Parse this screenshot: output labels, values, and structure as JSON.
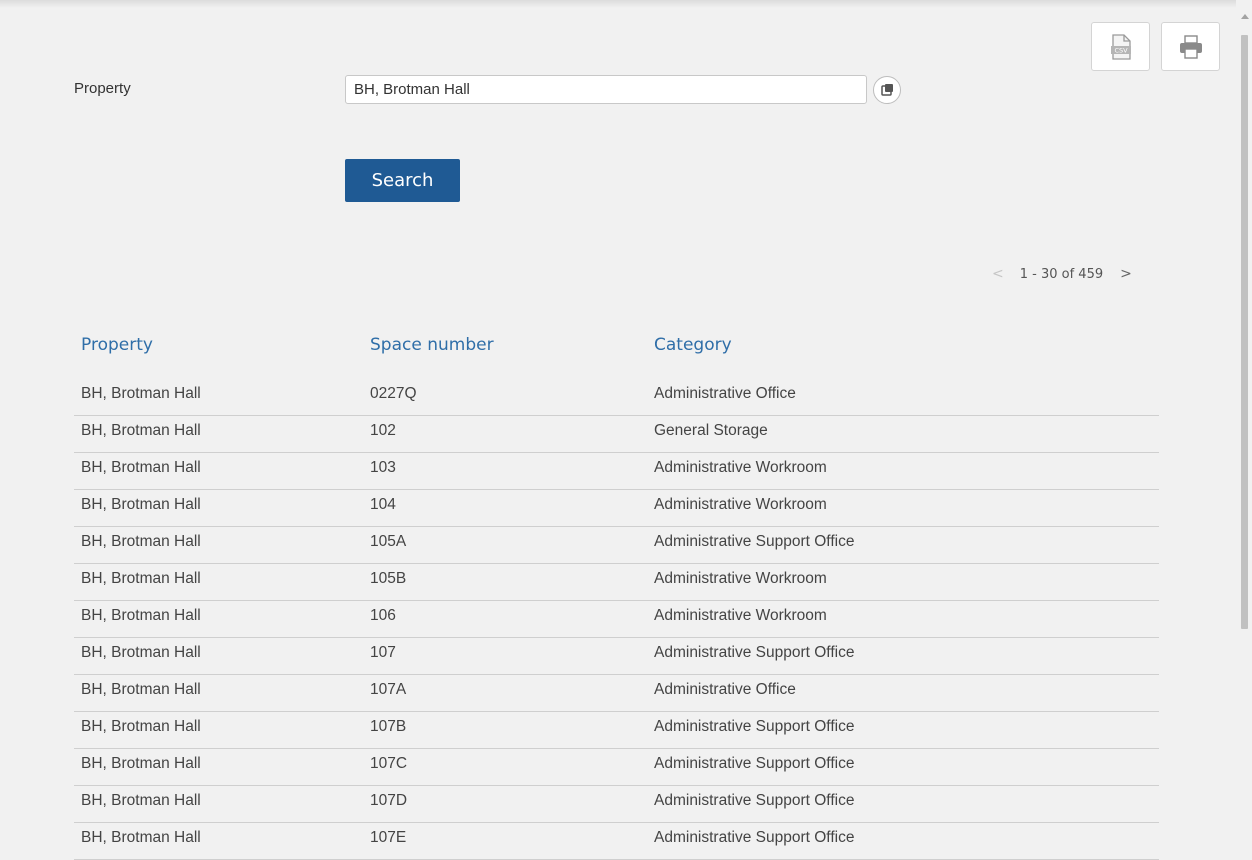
{
  "toolbar": {
    "export_csv_icon": "csv-file-icon",
    "print_icon": "printer-icon"
  },
  "filter": {
    "label": "Property",
    "value": "BH, Brotman Hall",
    "lookup_icon": "lookup-icon"
  },
  "search": {
    "label": "Search"
  },
  "pager": {
    "prev": "<",
    "range": "1 - 30 of 459",
    "next": ">"
  },
  "grid": {
    "columns": [
      "Property",
      "Space number",
      "Category"
    ],
    "rows": [
      [
        "BH, Brotman Hall",
        "0227Q",
        "Administrative Office"
      ],
      [
        "BH, Brotman Hall",
        "102",
        "General Storage"
      ],
      [
        "BH, Brotman Hall",
        "103",
        "Administrative Workroom"
      ],
      [
        "BH, Brotman Hall",
        "104",
        "Administrative Workroom"
      ],
      [
        "BH, Brotman Hall",
        "105A",
        "Administrative Support Office"
      ],
      [
        "BH, Brotman Hall",
        "105B",
        "Administrative Workroom"
      ],
      [
        "BH, Brotman Hall",
        "106",
        "Administrative Workroom"
      ],
      [
        "BH, Brotman Hall",
        "107",
        "Administrative Support Office"
      ],
      [
        "BH, Brotman Hall",
        "107A",
        "Administrative Office"
      ],
      [
        "BH, Brotman Hall",
        "107B",
        "Administrative Support Office"
      ],
      [
        "BH, Brotman Hall",
        "107C",
        "Administrative Support Office"
      ],
      [
        "BH, Brotman Hall",
        "107D",
        "Administrative Support Office"
      ],
      [
        "BH, Brotman Hall",
        "107E",
        "Administrative Support Office"
      ]
    ]
  },
  "colors": {
    "primary_button": "#1f5a94",
    "column_header": "#2f6ea8",
    "row_divider": "#cfcfcf"
  }
}
